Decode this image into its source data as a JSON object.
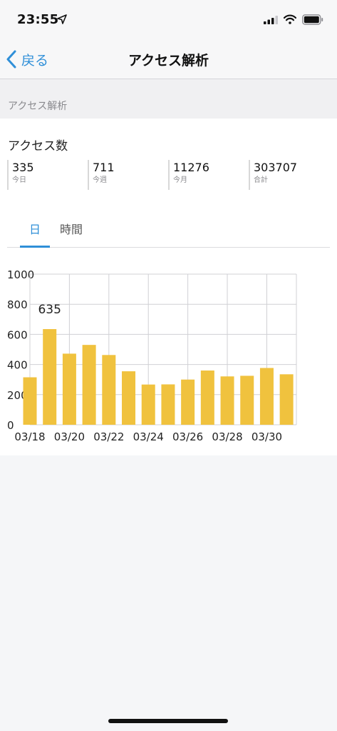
{
  "status_bar": {
    "time": "23:55"
  },
  "nav": {
    "back_label": "戻る",
    "title": "アクセス解析"
  },
  "section_header": "アクセス解析",
  "access": {
    "title": "アクセス数",
    "stats": [
      {
        "value": "335",
        "label": "今日"
      },
      {
        "value": "711",
        "label": "今週"
      },
      {
        "value": "11276",
        "label": "今月"
      },
      {
        "value": "303707",
        "label": "合計"
      }
    ]
  },
  "tabs": [
    {
      "label": "日",
      "active": true
    },
    {
      "label": "時間",
      "active": false
    }
  ],
  "colors": {
    "accent": "#2f8fd8",
    "bar": "#f0c23e"
  },
  "chart_data": {
    "type": "bar",
    "categories": [
      "03/18",
      "03/19",
      "03/20",
      "03/21",
      "03/22",
      "03/23",
      "03/24",
      "03/25",
      "03/26",
      "03/27",
      "03/28",
      "03/29",
      "03/30",
      "03/31"
    ],
    "values": [
      315,
      635,
      472,
      530,
      463,
      355,
      267,
      268,
      300,
      360,
      321,
      325,
      377,
      335
    ],
    "x_tick_labels": [
      "03/18",
      "03/20",
      "03/22",
      "03/24",
      "03/26",
      "03/28",
      "03/30"
    ],
    "y_ticks": [
      0,
      200,
      400,
      600,
      800,
      1000
    ],
    "ylim": [
      0,
      1000
    ],
    "annotation": {
      "category": "03/19",
      "text": "635"
    },
    "grid": true
  }
}
